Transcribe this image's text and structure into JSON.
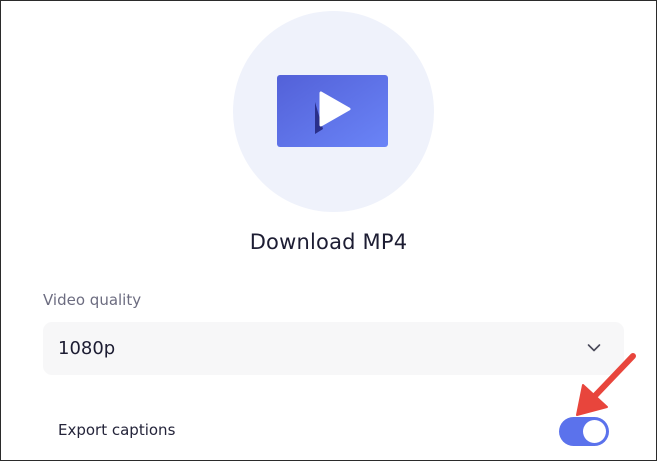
{
  "dialog": {
    "title": "Download MP4",
    "icon": "video-play-icon",
    "accent_color": "#5b72ec"
  },
  "video_quality": {
    "label": "Video quality",
    "selected": "1080p",
    "icon": "chevron-down-icon"
  },
  "export_captions": {
    "label": "Export captions",
    "enabled": true,
    "toggle_color": "#5b72ec"
  },
  "annotation": {
    "icon": "red-arrow-icon",
    "color": "#e8453c"
  }
}
